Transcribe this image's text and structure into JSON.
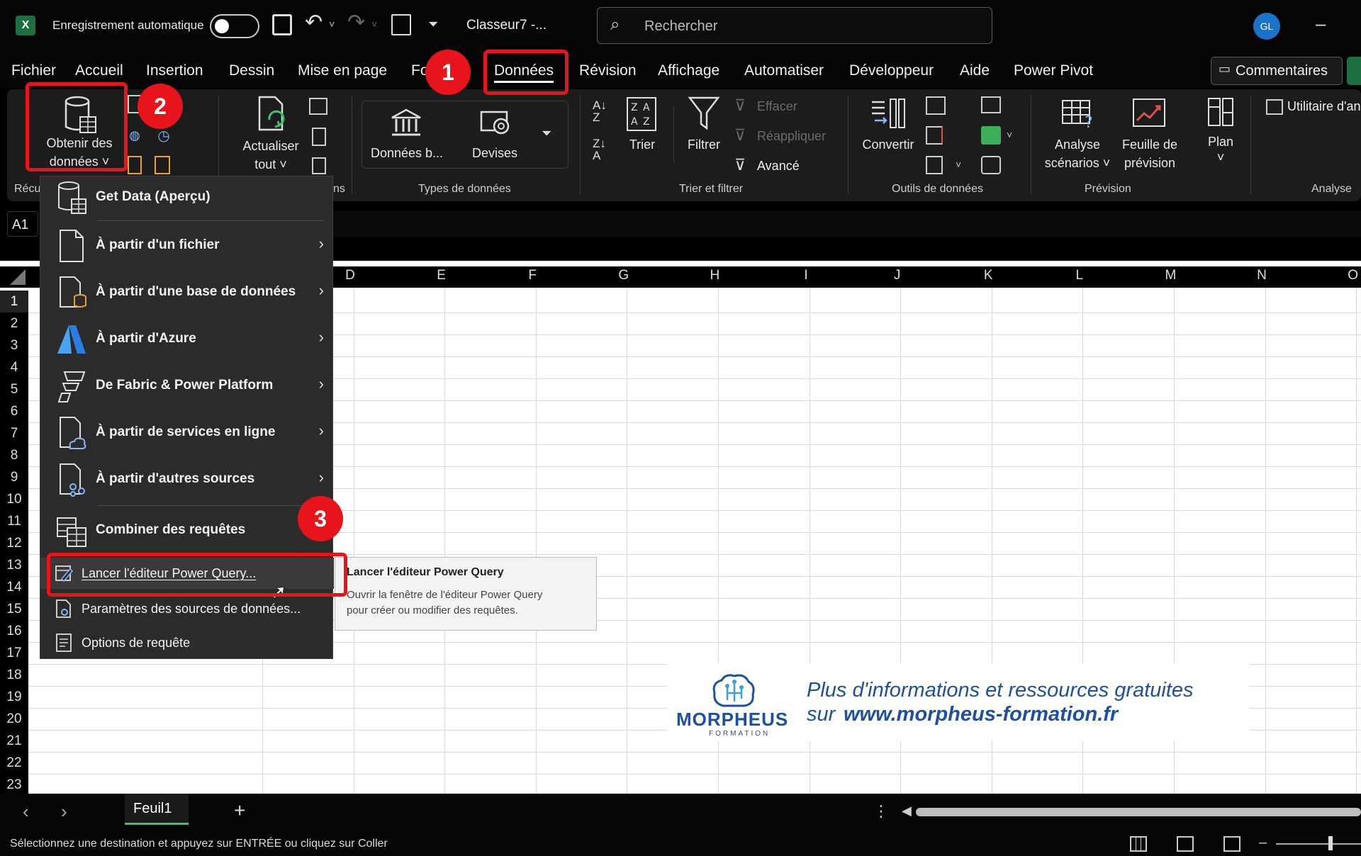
{
  "titlebar": {
    "autosave_label": "Enregistrement automatique",
    "doc_title": "Classeur7  -...",
    "search_placeholder": "Rechercher",
    "avatar_initials": "GL",
    "minimize": "–"
  },
  "tabs": [
    "Fichier",
    "Accueil",
    "Insertion",
    "Dessin",
    "Mise en page",
    "Fo",
    "Données",
    "Révision",
    "Affichage",
    "Automatiser",
    "Développeur",
    "Aide",
    "Power Pivot"
  ],
  "active_tab": "Données",
  "comments_label": "Commentaires",
  "ribbon": {
    "get_data_label_1": "Obtenir des",
    "get_data_label_2": "données ˅",
    "recup_group": "Récu",
    "refresh_label_1": "Actualiser",
    "refresh_label_2": "tout ˅",
    "queries_group_fragment": "ns",
    "data_types": {
      "stocks": "Données b...",
      "currencies": "Devises",
      "group": "Types de données"
    },
    "sort_filter": {
      "sort": "Trier",
      "filter": "Filtrer",
      "clear": "Effacer",
      "reapply": "Réappliquer",
      "advanced": "Avancé",
      "group": "Trier et filtrer"
    },
    "data_tools": {
      "convert": "Convertir",
      "group": "Outils de données"
    },
    "forecast": {
      "what_if_1": "Analyse",
      "what_if_2": "scénarios ˅",
      "forecast_1": "Feuille de",
      "forecast_2": "prévision",
      "group": "Prévision"
    },
    "outline": {
      "label": "Plan",
      "chevron": "˅"
    },
    "analysis": {
      "utility": "Utilitaire d'an",
      "group": "Analyse"
    }
  },
  "namebox": "A1",
  "columns": [
    "D",
    "E",
    "F",
    "G",
    "H",
    "I",
    "J",
    "K",
    "L",
    "M",
    "N",
    "O"
  ],
  "rows": [
    "1",
    "2",
    "3",
    "4",
    "5",
    "6",
    "7",
    "8",
    "9",
    "10",
    "11",
    "12",
    "13",
    "14",
    "15",
    "16",
    "17",
    "18",
    "19",
    "20",
    "21",
    "22",
    "23"
  ],
  "menu": {
    "items": [
      {
        "label": "Get Data (Aperçu)",
        "icon": "database-table-icon",
        "submenu": false
      },
      {
        "label": "À partir d'un fichier",
        "icon": "file-icon",
        "submenu": true
      },
      {
        "label": "À partir d'une base de données",
        "icon": "database-file-icon",
        "submenu": true
      },
      {
        "label": "À partir d'Azure",
        "icon": "azure-icon",
        "submenu": true
      },
      {
        "label": "De Fabric & Power Platform",
        "icon": "fabric-icon",
        "submenu": true
      },
      {
        "label": "À partir de services en ligne",
        "icon": "cloud-file-icon",
        "submenu": true
      },
      {
        "label": "À partir d'autres sources",
        "icon": "other-sources-icon",
        "submenu": true
      },
      {
        "label": "Combiner des requêtes",
        "icon": "combine-queries-icon",
        "submenu": true
      }
    ],
    "small_items": [
      {
        "label": "Lancer l'éditeur Power Query...",
        "icon": "power-query-editor-icon"
      },
      {
        "label": "Paramètres des sources de données...",
        "icon": "data-source-settings-icon"
      },
      {
        "label": "Options de requête",
        "icon": "query-options-icon"
      }
    ]
  },
  "tooltip": {
    "title": "Lancer l'éditeur Power Query",
    "line1": "Ouvrir la fenêtre de l'éditeur Power Query",
    "line2": "pour créer ou modifier des requêtes."
  },
  "badges": [
    "1",
    "2",
    "3"
  ],
  "promo": {
    "logo_text": "MORPHEUS",
    "logo_sub": "FORMATION",
    "line1": "Plus d'informations et ressources gratuites",
    "line2_prefix": "sur",
    "url": "www.morpheus-formation.fr"
  },
  "sheet_tab": "Feuil1",
  "add_sheet": "+",
  "status_text": "Sélectionnez une destination et appuyez sur ENTRÉE ou cliquez sur Coller",
  "colors": {
    "accent_red": "#e8141c",
    "excel_green": "#1d6f42",
    "avatar_blue": "#1a73c8",
    "promo_blue": "#1f4fa0"
  }
}
